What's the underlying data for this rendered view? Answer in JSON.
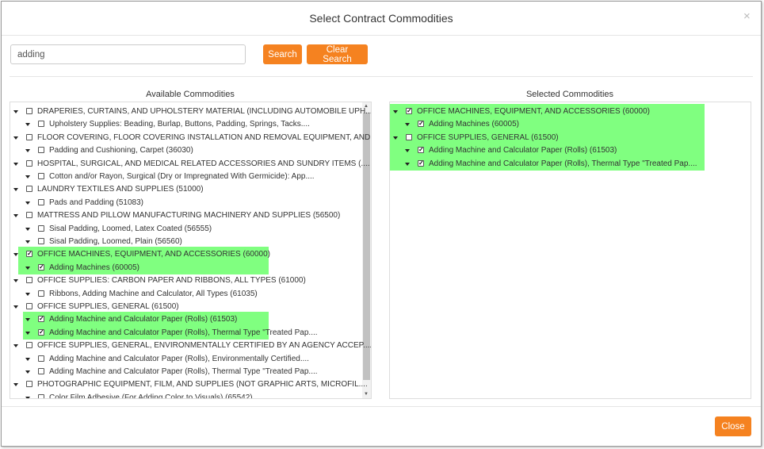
{
  "dialog": {
    "title": "Select Contract Commodities",
    "close_icon": "×"
  },
  "search": {
    "value": "adding",
    "search_label": "Search",
    "clear_label": "Clear Search"
  },
  "colors": {
    "accent": "#f58220",
    "highlight": "#80ff80"
  },
  "available": {
    "label": "Available Commodities",
    "items": [
      {
        "level": 0,
        "checked": false,
        "hl": false,
        "text": "DRAPERIES, CURTAINS, AND UPHOLSTERY MATERIAL (INCLUDING AUTOMOBILE UPH...."
      },
      {
        "level": 1,
        "checked": false,
        "hl": false,
        "text": "Upholstery Supplies: Beading, Burlap, Buttons, Padding, Springs, Tacks...."
      },
      {
        "level": 0,
        "checked": false,
        "hl": false,
        "text": "FLOOR COVERING, FLOOR COVERING INSTALLATION AND REMOVAL EQUIPMENT, AND...."
      },
      {
        "level": 1,
        "checked": false,
        "hl": false,
        "text": "Padding and Cushioning, Carpet (36030)"
      },
      {
        "level": 0,
        "checked": false,
        "hl": false,
        "text": "HOSPITAL, SURGICAL, AND MEDICAL RELATED ACCESSORIES AND SUNDRY ITEMS (...."
      },
      {
        "level": 1,
        "checked": false,
        "hl": false,
        "text": "Cotton and/or Rayon, Surgical (Dry or Impregnated With Germicide): App...."
      },
      {
        "level": 0,
        "checked": false,
        "hl": false,
        "text": "LAUNDRY TEXTILES AND SUPPLIES (51000)"
      },
      {
        "level": 1,
        "checked": false,
        "hl": false,
        "text": "Pads and Padding (51083)"
      },
      {
        "level": 0,
        "checked": false,
        "hl": false,
        "text": "MATTRESS AND PILLOW MANUFACTURING MACHINERY AND SUPPLIES (56500)"
      },
      {
        "level": 1,
        "checked": false,
        "hl": false,
        "text": "Sisal Padding, Loomed, Latex Coated (56555)"
      },
      {
        "level": 1,
        "checked": false,
        "hl": false,
        "text": "Sisal Padding, Loomed, Plain (56560)"
      },
      {
        "level": 0,
        "checked": true,
        "hl": true,
        "text": "OFFICE MACHINES, EQUIPMENT, AND ACCESSORIES (60000)"
      },
      {
        "level": 1,
        "checked": true,
        "hl": true,
        "text": "Adding Machines (60005)"
      },
      {
        "level": 0,
        "checked": false,
        "hl": false,
        "text": "OFFICE SUPPLIES: CARBON PAPER AND RIBBONS, ALL TYPES (61000)"
      },
      {
        "level": 1,
        "checked": false,
        "hl": false,
        "text": "Ribbons, Adding Machine and Calculator, All Types (61035)"
      },
      {
        "level": 0,
        "checked": false,
        "hl": false,
        "text": "OFFICE SUPPLIES, GENERAL (61500)"
      },
      {
        "level": 1,
        "checked": true,
        "hl": true,
        "text": "Adding Machine and Calculator Paper (Rolls) (61503)"
      },
      {
        "level": 1,
        "checked": true,
        "hl": true,
        "text": "Adding Machine and Calculator Paper (Rolls), Thermal Type \"Treated Pap...."
      },
      {
        "level": 0,
        "checked": false,
        "hl": false,
        "text": "OFFICE SUPPLIES, GENERAL, ENVIRONMENTALLY CERTIFIED BY AN AGENCY ACCEP...."
      },
      {
        "level": 1,
        "checked": false,
        "hl": false,
        "text": "Adding Machine and Calculator Paper (Rolls), Environmentally Certified...."
      },
      {
        "level": 1,
        "checked": false,
        "hl": false,
        "text": "Adding Machine and Calculator Paper (Rolls), Thermal Type \"Treated Pap...."
      },
      {
        "level": 0,
        "checked": false,
        "hl": false,
        "text": "PHOTOGRAPHIC EQUIPMENT, FILM, AND SUPPLIES (NOT GRAPHIC ARTS, MICROFIL...."
      },
      {
        "level": 1,
        "checked": false,
        "hl": false,
        "text": "Color Film Adhesive (For Adding Color to Visuals) (65542)"
      }
    ]
  },
  "selected": {
    "label": "Selected Commodities",
    "items": [
      {
        "level": 0,
        "checked": true,
        "hl": true,
        "text": "OFFICE MACHINES, EQUIPMENT, AND ACCESSORIES (60000)"
      },
      {
        "level": 1,
        "checked": true,
        "hl": true,
        "text": "Adding Machines (60005)"
      },
      {
        "level": 0,
        "checked": false,
        "hl": true,
        "text": "OFFICE SUPPLIES, GENERAL (61500)"
      },
      {
        "level": 1,
        "checked": true,
        "hl": true,
        "text": "Adding Machine and Calculator Paper (Rolls) (61503)"
      },
      {
        "level": 1,
        "checked": true,
        "hl": true,
        "text": "Adding Machine and Calculator Paper (Rolls), Thermal Type \"Treated Pap...."
      }
    ]
  },
  "footer": {
    "close_label": "Close"
  }
}
